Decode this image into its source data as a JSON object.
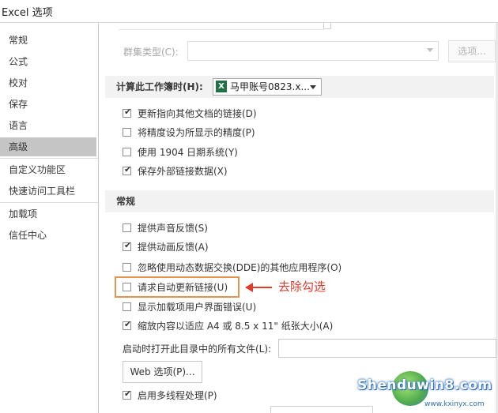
{
  "window": {
    "title": "Excel 选项"
  },
  "sidebar": {
    "items": [
      {
        "label": "常规"
      },
      {
        "label": "公式"
      },
      {
        "label": "校对"
      },
      {
        "label": "保存"
      },
      {
        "label": "语言"
      },
      {
        "label": "高级",
        "selected": true
      },
      {
        "label": "自定义功能区"
      },
      {
        "label": "快速访问工具栏"
      },
      {
        "label": "加载项"
      },
      {
        "label": "信任中心"
      }
    ]
  },
  "cluster": {
    "label": "群集类型(C):",
    "button": "选项..."
  },
  "calc_section": {
    "label": "计算此工作簿时(H):",
    "workbook": "马甲账号0823.x...",
    "options": [
      {
        "label": "更新指向其他文档的链接(D)",
        "checked": true
      },
      {
        "label": "将精度设为所显示的精度(P)",
        "checked": false
      },
      {
        "label": "使用 1904 日期系统(Y)",
        "checked": false
      },
      {
        "label": "保存外部链接数据(X)",
        "checked": true
      }
    ]
  },
  "general_section": {
    "label": "常规",
    "options": [
      {
        "label": "提供声音反馈(S)",
        "checked": false
      },
      {
        "label": "提供动画反馈(A)",
        "checked": true
      },
      {
        "label": "忽略使用动态数据交换(DDE)的其他应用程序(O)",
        "checked": false
      },
      {
        "label": "请求自动更新链接(U)",
        "checked": false
      },
      {
        "label": "显示加载项用户界面错误(U)",
        "checked": false
      },
      {
        "label": "缩放内容以适应 A4 或 8.5 x 11\" 纸张大小(A)",
        "checked": true
      }
    ],
    "startup_label": "启动时打开此目录中的所有文件(L):",
    "startup_value": "",
    "web_button": "Web 选项(P)...",
    "multithread": {
      "label": "启用多线程处理(P)",
      "checked": true
    }
  },
  "annotation": {
    "text": "去除勾选"
  },
  "watermark": {
    "text": "Shenduwin8.com",
    "url": "www.kxinyx.com"
  },
  "colors": {
    "accent": "#e2944f",
    "annotation": "#e03c2e",
    "selected_nav": "#c5c5c5",
    "excel_green": "#1e7145"
  }
}
